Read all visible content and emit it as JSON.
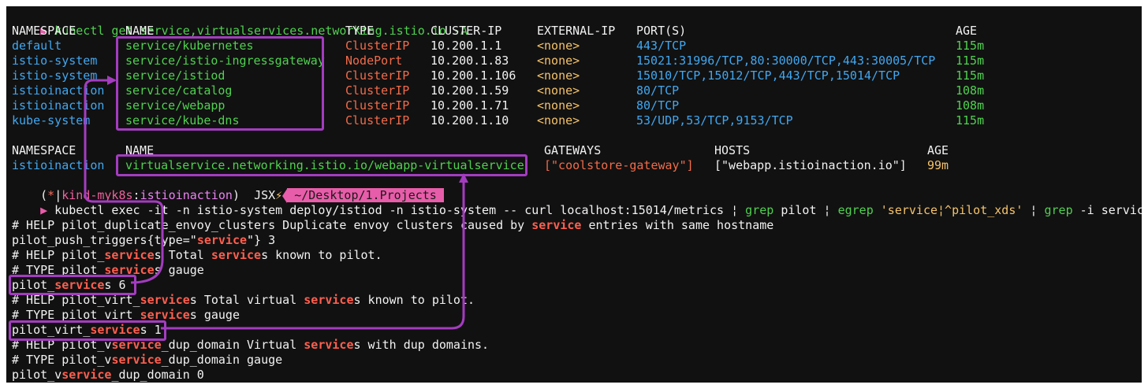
{
  "colors": {
    "accent": "#a43cc0",
    "green": "#4fd14f",
    "blue": "#41a7f0",
    "orange": "#f26b4a",
    "yellow": "#f5c36a",
    "pink": "#e85da9"
  },
  "cmd1": {
    "prompt": "▶",
    "text": " kubectl get service,virtualservices.networking.istio.io -A"
  },
  "svc_headers": [
    "NAMESPACE",
    "NAME",
    "TYPE",
    "CLUSTER-IP",
    "EXTERNAL-IP",
    "PORT(S)",
    "AGE"
  ],
  "services": [
    {
      "ns": "default",
      "name": "service/kubernetes",
      "type": "ClusterIP",
      "ip": "10.200.1.1",
      "ext": "<none>",
      "ports": "443/TCP",
      "age": "115m"
    },
    {
      "ns": "istio-system",
      "name": "service/istio-ingressgateway",
      "type": "NodePort",
      "ip": "10.200.1.83",
      "ext": "<none>",
      "ports": "15021:31996/TCP,80:30000/TCP,443:30005/TCP",
      "age": "115m"
    },
    {
      "ns": "istio-system",
      "name": "service/istiod",
      "type": "ClusterIP",
      "ip": "10.200.1.106",
      "ext": "<none>",
      "ports": "15010/TCP,15012/TCP,443/TCP,15014/TCP",
      "age": "115m"
    },
    {
      "ns": "istioinaction",
      "name": "service/catalog",
      "type": "ClusterIP",
      "ip": "10.200.1.59",
      "ext": "<none>",
      "ports": "80/TCP",
      "age": "108m"
    },
    {
      "ns": "istioinaction",
      "name": "service/webapp",
      "type": "ClusterIP",
      "ip": "10.200.1.71",
      "ext": "<none>",
      "ports": "80/TCP",
      "age": "108m"
    },
    {
      "ns": "kube-system",
      "name": "service/kube-dns",
      "type": "ClusterIP",
      "ip": "10.200.1.10",
      "ext": "<none>",
      "ports": "53/UDP,53/TCP,9153/TCP",
      "age": "115m"
    }
  ],
  "vs_headers": [
    "NAMESPACE",
    "NAME",
    "GATEWAYS",
    "HOSTS",
    "AGE"
  ],
  "virtualservice": {
    "ns": "istioinaction",
    "name": "virtualservice.networking.istio.io/webapp-virtualservice",
    "gateways": "[\"coolstore-gateway\"]",
    "hosts": "[\"webapp.istioinaction.io\"]",
    "age": "99m"
  },
  "status": {
    "open": "(",
    "star": "*",
    "sep": "|",
    "context": "kind-myk8s",
    "colon": ":",
    "namespace": "istioinaction",
    "close": ")",
    "jsx": "JSX",
    "bolt": "⚡",
    "path": " ~/Desktop/1.Projects "
  },
  "cmd2": {
    "prompt": "▶",
    "part1": " kubectl exec -it -n istio-system deploy/istiod -n istio-system -- curl localhost:15014/metrics ",
    "pipe": "¦",
    "grep": "grep",
    "pilot": " pilot ",
    "egrep": "egrep",
    "pattern": " 'service¦^pilot_xds' ",
    "grep_i": "grep",
    "flags": " -i service"
  },
  "output": [
    [
      {
        "t": "# HELP pilot_duplicate_envoy_clusters Duplicate envoy clusters caused by ",
        "k": "w"
      },
      {
        "t": "service",
        "k": "hl"
      },
      {
        "t": " entries with same hostname",
        "k": "w"
      }
    ],
    [
      {
        "t": "pilot_push_triggers{type=\"",
        "k": "w"
      },
      {
        "t": "service",
        "k": "hl"
      },
      {
        "t": "\"} 3",
        "k": "w"
      }
    ],
    [
      {
        "t": "# HELP pilot_",
        "k": "w"
      },
      {
        "t": "service",
        "k": "hl"
      },
      {
        "t": "s Total ",
        "k": "w"
      },
      {
        "t": "service",
        "k": "hl"
      },
      {
        "t": "s known to pilot.",
        "k": "w"
      }
    ],
    [
      {
        "t": "# TYPE pilot_",
        "k": "w"
      },
      {
        "t": "service",
        "k": "hl"
      },
      {
        "t": "s gauge",
        "k": "w"
      }
    ],
    [
      {
        "t": "pilot_",
        "k": "w"
      },
      {
        "t": "service",
        "k": "hl"
      },
      {
        "t": "s 6",
        "k": "w"
      }
    ],
    [
      {
        "t": "# HELP pilot_virt_",
        "k": "w"
      },
      {
        "t": "service",
        "k": "hl"
      },
      {
        "t": "s Total virtual ",
        "k": "w"
      },
      {
        "t": "service",
        "k": "hl"
      },
      {
        "t": "s known to pilot.",
        "k": "w"
      }
    ],
    [
      {
        "t": "# TYPE pilot_virt_",
        "k": "w"
      },
      {
        "t": "service",
        "k": "hl"
      },
      {
        "t": "s gauge",
        "k": "w"
      }
    ],
    [
      {
        "t": "pilot_virt_",
        "k": "w"
      },
      {
        "t": "service",
        "k": "hl"
      },
      {
        "t": "s 1",
        "k": "w"
      }
    ],
    [
      {
        "t": "# HELP pilot_v",
        "k": "w"
      },
      {
        "t": "service",
        "k": "hl"
      },
      {
        "t": "_dup_domain Virtual ",
        "k": "w"
      },
      {
        "t": "service",
        "k": "hl"
      },
      {
        "t": "s with dup domains.",
        "k": "w"
      }
    ],
    [
      {
        "t": "# TYPE pilot_v",
        "k": "w"
      },
      {
        "t": "service",
        "k": "hl"
      },
      {
        "t": "_dup_domain gauge",
        "k": "w"
      }
    ],
    [
      {
        "t": "pilot_v",
        "k": "w"
      },
      {
        "t": "service",
        "k": "hl"
      },
      {
        "t": "_dup_domain 0",
        "k": "w"
      }
    ]
  ]
}
